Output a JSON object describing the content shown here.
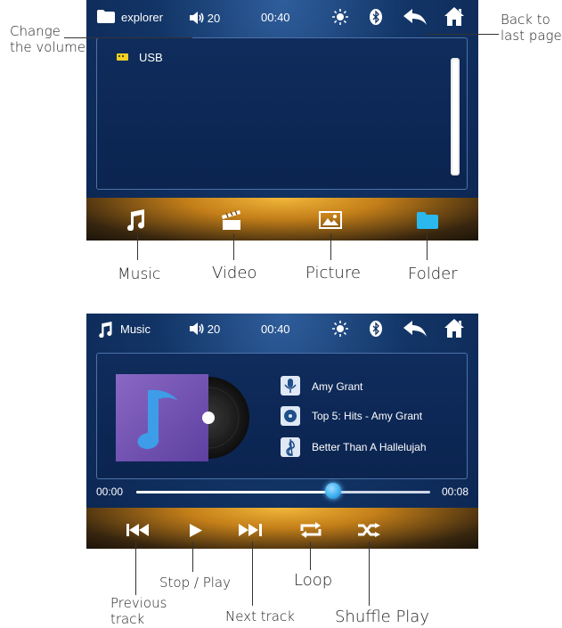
{
  "annotations": {
    "change_volume": "Change\nthe volume",
    "back": "Back to\nlast page",
    "music": "Music",
    "video": "Video",
    "picture": "Picture",
    "folder": "Folder",
    "previous": "Previous\ntrack",
    "stop_play": "Stop / Play",
    "next": "Next track",
    "loop": "Loop",
    "shuffle": "Shuffle Play"
  },
  "explorer_screen": {
    "title": "explorer",
    "volume": "20",
    "time": "00:40",
    "usb_label": "USB"
  },
  "music_screen": {
    "title": "Music",
    "volume": "20",
    "time": "00:40",
    "artist": "Amy Grant",
    "album": "Top 5: Hits - Amy Grant",
    "song": "Better Than A Hallelujah",
    "elapsed": "00:00",
    "total": "00:08",
    "progress": 0.67
  },
  "colors": {
    "screen_bg": "#123566",
    "accent_orange": "#f2b73a",
    "folder_cyan": "#2ab8ee",
    "progress_knob": "#3fb0f0"
  },
  "icons": [
    "folder-icon",
    "speaker-icon",
    "brightness-icon",
    "bluetooth-icon",
    "back-arrow-icon",
    "home-icon",
    "music-note-icon",
    "video-clapper-icon",
    "picture-icon",
    "microphone-icon",
    "album-disc-icon",
    "song-clef-icon",
    "previous-track-icon",
    "play-icon",
    "next-track-icon",
    "loop-icon",
    "shuffle-icon"
  ]
}
